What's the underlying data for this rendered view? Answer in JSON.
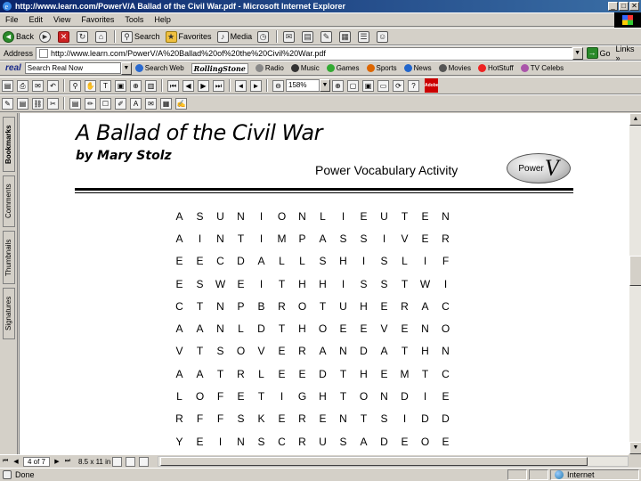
{
  "window": {
    "title": "http://www.learn.com/PowerV/A Ballad of the Civil War.pdf - Microsoft Internet Explorer",
    "minimize": "_",
    "maximize": "□",
    "close": "✕"
  },
  "menu": [
    "File",
    "Edit",
    "View",
    "Favorites",
    "Tools",
    "Help"
  ],
  "toolbar": {
    "back": "Back",
    "search": "Search",
    "favorites": "Favorites",
    "media": "Media"
  },
  "address": {
    "label": "Address",
    "url": "http://www.learn.com/PowerV/A%20Ballad%20of%20the%20Civil%20War.pdf",
    "go": "Go",
    "links": "Links »"
  },
  "realbar": {
    "logo": "real",
    "search_value": "Search Real Now",
    "search_web": "Search Web",
    "rolling": "RollingStone",
    "items": [
      "Radio",
      "Music",
      "Games",
      "Sports",
      "News",
      "Movies",
      "HotStuff",
      "TV Celebs"
    ]
  },
  "acrobat": {
    "zoom": "158%",
    "page_current": "4 of 7",
    "page_size": "8.5 x 11 in"
  },
  "nav_tabs": [
    "Bookmarks",
    "Comments",
    "Thumbnails",
    "Signatures"
  ],
  "doc": {
    "title": "A Ballad of the Civil War",
    "author": "by Mary Stolz",
    "activity": "Power Vocabulary Activity",
    "logo_power": "Power",
    "logo_v": "V"
  },
  "puzzle": {
    "rows": [
      [
        "A",
        "S",
        "U",
        "N",
        "I",
        "O",
        "N",
        "L",
        "I",
        "E",
        "U",
        "T",
        "E",
        "N"
      ],
      [
        "A",
        "I",
        "N",
        "T",
        "I",
        "M",
        "P",
        "A",
        "S",
        "S",
        "I",
        "V",
        "E",
        "R"
      ],
      [
        "E",
        "E",
        "C",
        "D",
        "A",
        "L",
        "L",
        "S",
        "H",
        "I",
        "S",
        "L",
        "I",
        "F"
      ],
      [
        "E",
        "S",
        "W",
        "E",
        "I",
        "T",
        "H",
        "H",
        "I",
        "S",
        "S",
        "T",
        "W",
        "I"
      ],
      [
        "C",
        "T",
        "N",
        "P",
        "B",
        "R",
        "O",
        "T",
        "U",
        "H",
        "E",
        "R",
        "A",
        "C"
      ],
      [
        "A",
        "A",
        "N",
        "L",
        "D",
        "T",
        "H",
        "O",
        "E",
        "E",
        "V",
        "E",
        "N",
        "O"
      ],
      [
        "V",
        "T",
        "S",
        "O",
        "V",
        "E",
        "R",
        "A",
        "N",
        "D",
        "A",
        "T",
        "H",
        "N"
      ],
      [
        "A",
        "A",
        "T",
        "R",
        "L",
        "E",
        "E",
        "D",
        "T",
        "H",
        "E",
        "M",
        "T",
        "C"
      ],
      [
        "L",
        "O",
        "F",
        "E",
        "T",
        "I",
        "G",
        "H",
        "T",
        "O",
        "N",
        "D",
        "I",
        "E"
      ],
      [
        "R",
        "F",
        "F",
        "S",
        "K",
        "E",
        "R",
        "E",
        "N",
        "T",
        "S",
        "I",
        "D",
        "D"
      ],
      [
        "Y",
        "E",
        "I",
        "N",
        "S",
        "C",
        "R",
        "U",
        "S",
        "A",
        "D",
        "E",
        "O",
        "E"
      ]
    ]
  },
  "status": {
    "text": "Done",
    "zone": "Internet"
  }
}
